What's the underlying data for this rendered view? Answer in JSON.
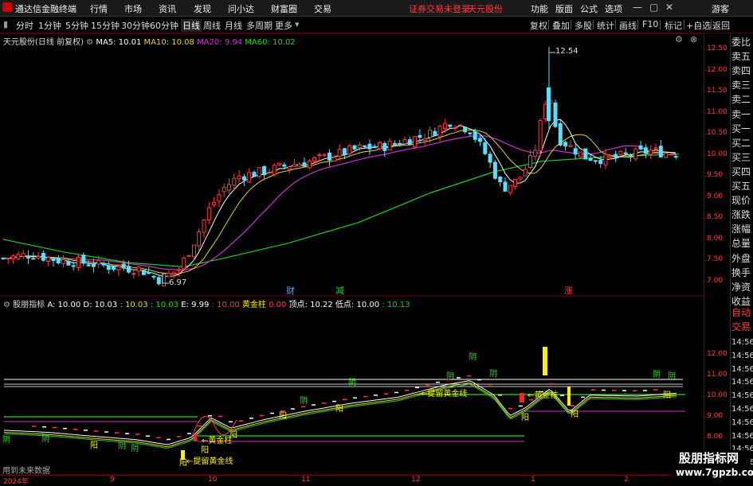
{
  "titlebar": {
    "app_title": "通达信金融终端",
    "menus": [
      "行情",
      "市场",
      "资讯",
      "发现",
      "问小达",
      "财富圈",
      "交易"
    ],
    "alert": "证券交易未登录",
    "stock": "天元股份",
    "right_menus": [
      "功能",
      "版面",
      "公式",
      "选项"
    ],
    "guest": "游客"
  },
  "toolbar": {
    "periods": [
      "分时",
      "1分钟",
      "5分钟",
      "15分钟",
      "30分钟",
      "60分钟",
      "日线",
      "周线",
      "月线",
      "多周期",
      "更多"
    ],
    "active_period": "日线",
    "right_buttons": [
      "复权",
      "叠加",
      "多股",
      "统计",
      "画线",
      "F10",
      "标记",
      "+自选",
      "返回"
    ]
  },
  "chart_header": {
    "title": "天元股份(日线 前复权)",
    "ma5": "MA5: 10.01",
    "ma10": "MA10: 10.08",
    "ma20": "MA20: 9.94",
    "ma60": "MA60: 10.02"
  },
  "indicator_header": {
    "name": "股朋指标",
    "a": "A: 10.00",
    "d": "D: 10.03",
    "x": ": 10.03",
    "y": ": 10.03",
    "e": "E: 9.99",
    "f": ": 10.00",
    "gold_label": "黄金柱",
    "gold_value": "0.00",
    "top": "顶点: 10.22",
    "bottom": "低点: 10.00",
    "last": ": 10.13"
  },
  "price_axis": [
    "12.50",
    "12.00",
    "11.50",
    "11.00",
    "10.50",
    "10.00",
    "9.50",
    "9.00",
    "8.50",
    "8.00",
    "7.50",
    "7.00"
  ],
  "indicator_axis": [
    "12.00",
    "11.00",
    "10.00",
    "9.00",
    "8.00"
  ],
  "sidebar": [
    "委比",
    "卖五",
    "卖四",
    "卖三",
    "卖二",
    "卖一",
    "买一",
    "买二",
    "买三",
    "买四",
    "买五",
    "现价",
    "涨跌",
    "涨幅",
    "总量",
    "外盘",
    "换手",
    "净资",
    "收益",
    "自动",
    "交易"
  ],
  "sidebar_times": [
    "14:56",
    "14:56",
    "14:56",
    "14:56",
    "14:56",
    "14:56",
    "14:56",
    "14:56",
    "14:56",
    "14:56",
    "14:56"
  ],
  "date_axis": [
    "2024年",
    "9",
    "10",
    "11",
    "12",
    "1",
    "2"
  ],
  "annotations": {
    "high": "12.54",
    "low": "6.97",
    "cai": "财",
    "jian": "减",
    "zhang": "涨",
    "line_label_1": "提留黄金线",
    "line_label_2": "提留黄金线",
    "gold_pillar": "黄金柱",
    "future": "用到未来数据",
    "yin": "阴",
    "yang": "阳"
  },
  "watermark": {
    "line1": "股朋指标网",
    "line2": "www.7gpzb.com"
  }
}
